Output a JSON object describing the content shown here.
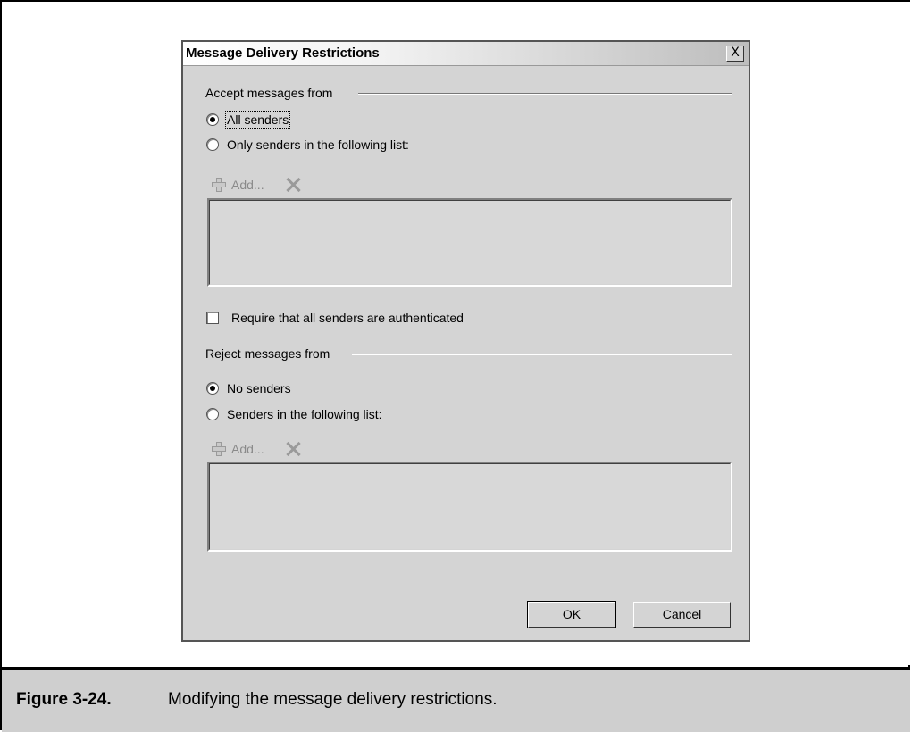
{
  "dialog": {
    "title": "Message Delivery Restrictions",
    "close_label": "X",
    "accept": {
      "group_label": "Accept messages from",
      "option_all": "All senders",
      "option_only": "Only senders in the following list:",
      "add_label": "Add..."
    },
    "require_auth_label": "Require that all senders are authenticated",
    "reject": {
      "group_label": "Reject messages from",
      "option_none": "No senders",
      "option_list": "Senders in the following list:",
      "add_label": "Add..."
    },
    "ok_label": "OK",
    "cancel_label": "Cancel"
  },
  "caption": {
    "number": "Figure 3-24.",
    "text": "Modifying the message delivery restrictions."
  }
}
